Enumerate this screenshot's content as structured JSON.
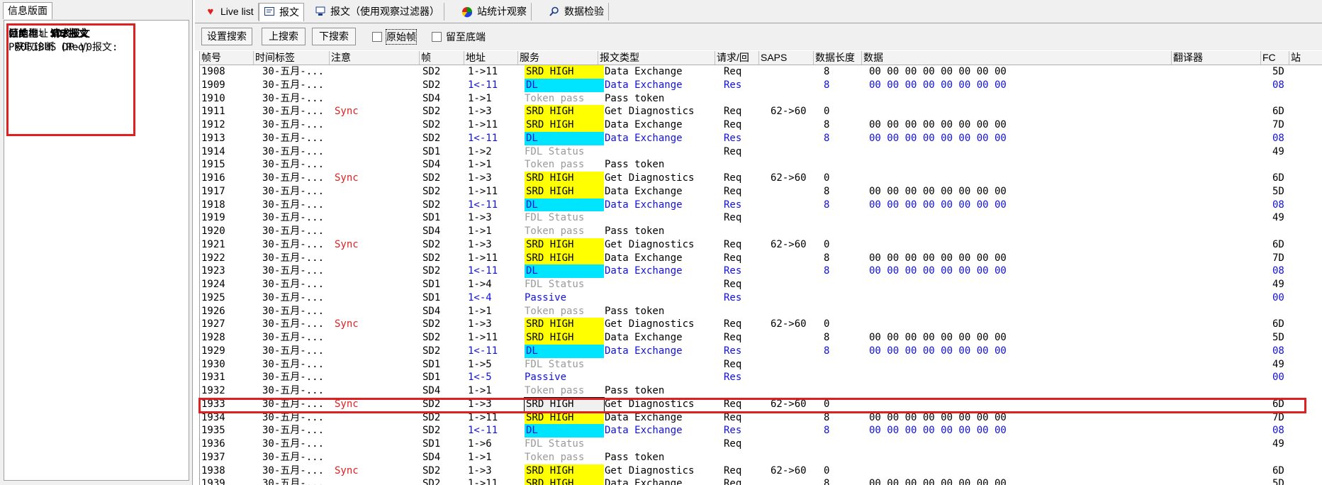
{
  "left_panel": {
    "tab_label": "信息版面",
    "info": {
      "frame_struct_label": "帧结构:",
      "frame_struct_value": "SD2报文",
      "src_label": "源地址:",
      "src_value": "1",
      "dst_label": "目的地址:",
      "dst_value": "3",
      "frame_type_label": "帧类型:",
      "frame_type_value": "请求报文",
      "profibus_label": "PROFIBUS DP-V0报文:",
      "profibus_value": " 获取诊断 (Req)"
    }
  },
  "tabs": [
    {
      "label": "Live list",
      "icon": "heart-icon"
    },
    {
      "label": "报文",
      "icon": "message-icon"
    },
    {
      "label": "报文（使用观察过滤器）",
      "icon": "filter-message-icon"
    },
    {
      "label": "站统计观察",
      "icon": "pie-chart-icon"
    },
    {
      "label": "数据检验",
      "icon": "search-icon"
    }
  ],
  "toolbar": {
    "set_search": "设置搜索",
    "prev_search": "上搜索",
    "next_search": "下搜索",
    "raw_frame": "原始帧",
    "stay_bottom": "留至底端"
  },
  "columns": [
    "帧号",
    "时间标签",
    "注意",
    "帧",
    "地址",
    "服务",
    "报文类型",
    "请求/回",
    "SAPS",
    "数据长度",
    "数据",
    "翻译器",
    "FC",
    "站"
  ],
  "rows": [
    {
      "num": "1908",
      "time": "30-五月-...",
      "note": "",
      "frame": "SD2",
      "addr": "1->11",
      "svc": "SRD HIGH",
      "svc_style": "yellow",
      "type": "Data Exchange",
      "req": "Req",
      "saps": "",
      "len": "8",
      "data": "00 00 00 00 00 00 00 00",
      "fc": "5D",
      "color": "black"
    },
    {
      "num": "1909",
      "time": "30-五月-...",
      "note": "",
      "frame": "SD2",
      "addr": "1<-11",
      "svc": "DL",
      "svc_style": "cyan",
      "type": "Data Exchange",
      "req": "Res",
      "saps": "",
      "len": "8",
      "data": "00 00 00 00 00 00 00 00",
      "fc": "08",
      "color": "blue"
    },
    {
      "num": "1910",
      "time": "30-五月-...",
      "note": "",
      "frame": "SD4",
      "addr": "1->1",
      "svc": "Token pass",
      "svc_style": "grey",
      "type": "Pass token",
      "req": "",
      "saps": "",
      "len": "",
      "data": "",
      "fc": "",
      "color": "black"
    },
    {
      "num": "1911",
      "time": "30-五月-...",
      "note": "Sync",
      "frame": "SD2",
      "addr": "1->3",
      "svc": "SRD HIGH",
      "svc_style": "yellow",
      "type": "Get Diagnostics",
      "req": "Req",
      "saps": "62->60",
      "len": "0",
      "data": "",
      "fc": "6D",
      "color": "black"
    },
    {
      "num": "1912",
      "time": "30-五月-...",
      "note": "",
      "frame": "SD2",
      "addr": "1->11",
      "svc": "SRD HIGH",
      "svc_style": "yellow",
      "type": "Data Exchange",
      "req": "Req",
      "saps": "",
      "len": "8",
      "data": "00 00 00 00 00 00 00 00",
      "fc": "7D",
      "color": "black"
    },
    {
      "num": "1913",
      "time": "30-五月-...",
      "note": "",
      "frame": "SD2",
      "addr": "1<-11",
      "svc": "DL",
      "svc_style": "cyan",
      "type": "Data Exchange",
      "req": "Res",
      "saps": "",
      "len": "8",
      "data": "00 00 00 00 00 00 00 00",
      "fc": "08",
      "color": "blue"
    },
    {
      "num": "1914",
      "time": "30-五月-...",
      "note": "",
      "frame": "SD1",
      "addr": "1->2",
      "svc": "FDL Status",
      "svc_style": "grey",
      "type": "",
      "req": "Req",
      "saps": "",
      "len": "",
      "data": "",
      "fc": "49",
      "color": "black"
    },
    {
      "num": "1915",
      "time": "30-五月-...",
      "note": "",
      "frame": "SD4",
      "addr": "1->1",
      "svc": "Token pass",
      "svc_style": "grey",
      "type": "Pass token",
      "req": "",
      "saps": "",
      "len": "",
      "data": "",
      "fc": "",
      "color": "black"
    },
    {
      "num": "1916",
      "time": "30-五月-...",
      "note": "Sync",
      "frame": "SD2",
      "addr": "1->3",
      "svc": "SRD HIGH",
      "svc_style": "yellow",
      "type": "Get Diagnostics",
      "req": "Req",
      "saps": "62->60",
      "len": "0",
      "data": "",
      "fc": "6D",
      "color": "black"
    },
    {
      "num": "1917",
      "time": "30-五月-...",
      "note": "",
      "frame": "SD2",
      "addr": "1->11",
      "svc": "SRD HIGH",
      "svc_style": "yellow",
      "type": "Data Exchange",
      "req": "Req",
      "saps": "",
      "len": "8",
      "data": "00 00 00 00 00 00 00 00",
      "fc": "5D",
      "color": "black"
    },
    {
      "num": "1918",
      "time": "30-五月-...",
      "note": "",
      "frame": "SD2",
      "addr": "1<-11",
      "svc": "DL",
      "svc_style": "cyan",
      "type": "Data Exchange",
      "req": "Res",
      "saps": "",
      "len": "8",
      "data": "00 00 00 00 00 00 00 00",
      "fc": "08",
      "color": "blue"
    },
    {
      "num": "1919",
      "time": "30-五月-...",
      "note": "",
      "frame": "SD1",
      "addr": "1->3",
      "svc": "FDL Status",
      "svc_style": "grey",
      "type": "",
      "req": "Req",
      "saps": "",
      "len": "",
      "data": "",
      "fc": "49",
      "color": "black"
    },
    {
      "num": "1920",
      "time": "30-五月-...",
      "note": "",
      "frame": "SD4",
      "addr": "1->1",
      "svc": "Token pass",
      "svc_style": "grey",
      "type": "Pass token",
      "req": "",
      "saps": "",
      "len": "",
      "data": "",
      "fc": "",
      "color": "black"
    },
    {
      "num": "1921",
      "time": "30-五月-...",
      "note": "Sync",
      "frame": "SD2",
      "addr": "1->3",
      "svc": "SRD HIGH",
      "svc_style": "yellow",
      "type": "Get Diagnostics",
      "req": "Req",
      "saps": "62->60",
      "len": "0",
      "data": "",
      "fc": "6D",
      "color": "black"
    },
    {
      "num": "1922",
      "time": "30-五月-...",
      "note": "",
      "frame": "SD2",
      "addr": "1->11",
      "svc": "SRD HIGH",
      "svc_style": "yellow",
      "type": "Data Exchange",
      "req": "Req",
      "saps": "",
      "len": "8",
      "data": "00 00 00 00 00 00 00 00",
      "fc": "7D",
      "color": "black"
    },
    {
      "num": "1923",
      "time": "30-五月-...",
      "note": "",
      "frame": "SD2",
      "addr": "1<-11",
      "svc": "DL",
      "svc_style": "cyan",
      "type": "Data Exchange",
      "req": "Res",
      "saps": "",
      "len": "8",
      "data": "00 00 00 00 00 00 00 00",
      "fc": "08",
      "color": "blue"
    },
    {
      "num": "1924",
      "time": "30-五月-...",
      "note": "",
      "frame": "SD1",
      "addr": "1->4",
      "svc": "FDL Status",
      "svc_style": "grey",
      "type": "",
      "req": "Req",
      "saps": "",
      "len": "",
      "data": "",
      "fc": "49",
      "color": "black"
    },
    {
      "num": "1925",
      "time": "30-五月-...",
      "note": "",
      "frame": "SD1",
      "addr": "1<-4",
      "svc": "Passive",
      "svc_style": "blue",
      "type": "",
      "req": "Res",
      "saps": "",
      "len": "",
      "data": "",
      "fc": "00",
      "color": "blue"
    },
    {
      "num": "1926",
      "time": "30-五月-...",
      "note": "",
      "frame": "SD4",
      "addr": "1->1",
      "svc": "Token pass",
      "svc_style": "grey",
      "type": "Pass token",
      "req": "",
      "saps": "",
      "len": "",
      "data": "",
      "fc": "",
      "color": "black"
    },
    {
      "num": "1927",
      "time": "30-五月-...",
      "note": "Sync",
      "frame": "SD2",
      "addr": "1->3",
      "svc": "SRD HIGH",
      "svc_style": "yellow",
      "type": "Get Diagnostics",
      "req": "Req",
      "saps": "62->60",
      "len": "0",
      "data": "",
      "fc": "6D",
      "color": "black"
    },
    {
      "num": "1928",
      "time": "30-五月-...",
      "note": "",
      "frame": "SD2",
      "addr": "1->11",
      "svc": "SRD HIGH",
      "svc_style": "yellow",
      "type": "Data Exchange",
      "req": "Req",
      "saps": "",
      "len": "8",
      "data": "00 00 00 00 00 00 00 00",
      "fc": "5D",
      "color": "black"
    },
    {
      "num": "1929",
      "time": "30-五月-...",
      "note": "",
      "frame": "SD2",
      "addr": "1<-11",
      "svc": "DL",
      "svc_style": "cyan",
      "type": "Data Exchange",
      "req": "Res",
      "saps": "",
      "len": "8",
      "data": "00 00 00 00 00 00 00 00",
      "fc": "08",
      "color": "blue"
    },
    {
      "num": "1930",
      "time": "30-五月-...",
      "note": "",
      "frame": "SD1",
      "addr": "1->5",
      "svc": "FDL Status",
      "svc_style": "grey",
      "type": "",
      "req": "Req",
      "saps": "",
      "len": "",
      "data": "",
      "fc": "49",
      "color": "black"
    },
    {
      "num": "1931",
      "time": "30-五月-...",
      "note": "",
      "frame": "SD1",
      "addr": "1<-5",
      "svc": "Passive",
      "svc_style": "blue",
      "type": "",
      "req": "Res",
      "saps": "",
      "len": "",
      "data": "",
      "fc": "00",
      "color": "blue"
    },
    {
      "num": "1932",
      "time": "30-五月-...",
      "note": "",
      "frame": "SD4",
      "addr": "1->1",
      "svc": "Token pass",
      "svc_style": "grey",
      "type": "Pass token",
      "req": "",
      "saps": "",
      "len": "",
      "data": "",
      "fc": "",
      "color": "black"
    },
    {
      "num": "1933",
      "time": "30-五月-...",
      "note": "Sync",
      "frame": "SD2",
      "addr": "1->3",
      "svc": "SRD HIGH",
      "svc_style": "selected",
      "type": "Get Diagnostics",
      "req": "Req",
      "saps": "62->60",
      "len": "0",
      "data": "",
      "fc": "6D",
      "color": "black"
    },
    {
      "num": "1934",
      "time": "30-五月-...",
      "note": "",
      "frame": "SD2",
      "addr": "1->11",
      "svc": "SRD HIGH",
      "svc_style": "yellow",
      "type": "Data Exchange",
      "req": "Req",
      "saps": "",
      "len": "8",
      "data": "00 00 00 00 00 00 00 00",
      "fc": "7D",
      "color": "black"
    },
    {
      "num": "1935",
      "time": "30-五月-...",
      "note": "",
      "frame": "SD2",
      "addr": "1<-11",
      "svc": "DL",
      "svc_style": "cyan",
      "type": "Data Exchange",
      "req": "Res",
      "saps": "",
      "len": "8",
      "data": "00 00 00 00 00 00 00 00",
      "fc": "08",
      "color": "blue"
    },
    {
      "num": "1936",
      "time": "30-五月-...",
      "note": "",
      "frame": "SD1",
      "addr": "1->6",
      "svc": "FDL Status",
      "svc_style": "grey",
      "type": "",
      "req": "Req",
      "saps": "",
      "len": "",
      "data": "",
      "fc": "49",
      "color": "black"
    },
    {
      "num": "1937",
      "time": "30-五月-...",
      "note": "",
      "frame": "SD4",
      "addr": "1->1",
      "svc": "Token pass",
      "svc_style": "grey",
      "type": "Pass token",
      "req": "",
      "saps": "",
      "len": "",
      "data": "",
      "fc": "",
      "color": "black"
    },
    {
      "num": "1938",
      "time": "30-五月-...",
      "note": "Sync",
      "frame": "SD2",
      "addr": "1->3",
      "svc": "SRD HIGH",
      "svc_style": "yellow",
      "type": "Get Diagnostics",
      "req": "Req",
      "saps": "62->60",
      "len": "0",
      "data": "",
      "fc": "6D",
      "color": "black"
    },
    {
      "num": "1939",
      "time": "30-五月-...",
      "note": "",
      "frame": "SD2",
      "addr": "1->11",
      "svc": "SRD HIGH",
      "svc_style": "yellow",
      "type": "Data Exchange",
      "req": "Req",
      "saps": "",
      "len": "8",
      "data": "00 00 00 00 00 00 00 00",
      "fc": "5D",
      "color": "black"
    }
  ],
  "colors": {
    "highlight": "#e02020",
    "yellow": "#ffff00",
    "cyan": "#00e5ff",
    "blue": "#1010e0",
    "grey": "#9a9a9a"
  }
}
